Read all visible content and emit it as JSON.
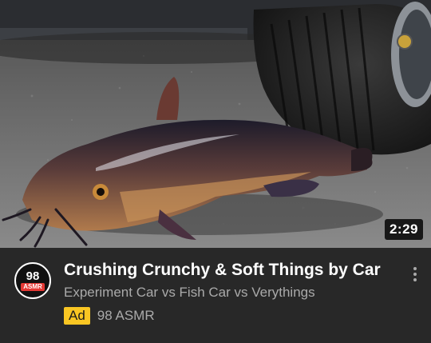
{
  "video": {
    "duration": "2:29",
    "title": "Crushing Crunchy & Soft Things by Car",
    "subtitle": "Experiment Car vs Fish Car vs Verythings",
    "ad_label": "Ad",
    "channel": "98 ASMR",
    "avatar": {
      "number": "98",
      "label": "ASMR"
    }
  },
  "icons": {
    "menu": "more-vert-icon"
  },
  "colors": {
    "background": "#282828",
    "ad_badge": "#f9c623",
    "secondary_text": "#aaaaaa"
  }
}
